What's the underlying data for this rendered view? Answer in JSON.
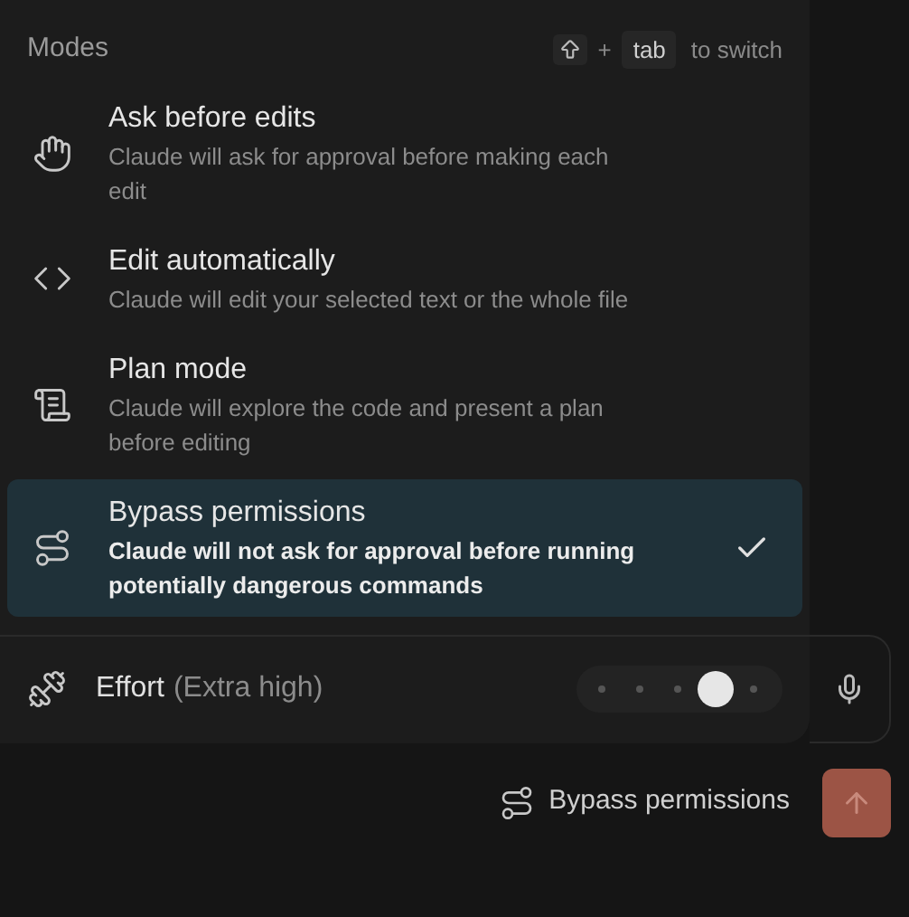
{
  "header": {
    "title": "Modes",
    "shortcut": {
      "plus": "+",
      "key": "tab",
      "hint": "to switch"
    }
  },
  "modes": [
    {
      "kind": "hand",
      "title": "Ask before edits",
      "description": "Claude will ask for approval before making each edit",
      "selected": false
    },
    {
      "kind": "code",
      "title": "Edit automatically",
      "description": "Claude will edit your selected text or the whole file",
      "selected": false
    },
    {
      "kind": "scroll",
      "title": "Plan mode",
      "description": "Claude will explore the code and present a plan before editing",
      "selected": false
    },
    {
      "kind": "route",
      "title": "Bypass permissions",
      "description": "Claude will not ask for approval before running potentially dangerous commands",
      "selected": true
    }
  ],
  "effort": {
    "label": "Effort",
    "value": "(Extra high)",
    "level": 0.75
  },
  "footer": {
    "mode_label": "Bypass permissions"
  }
}
